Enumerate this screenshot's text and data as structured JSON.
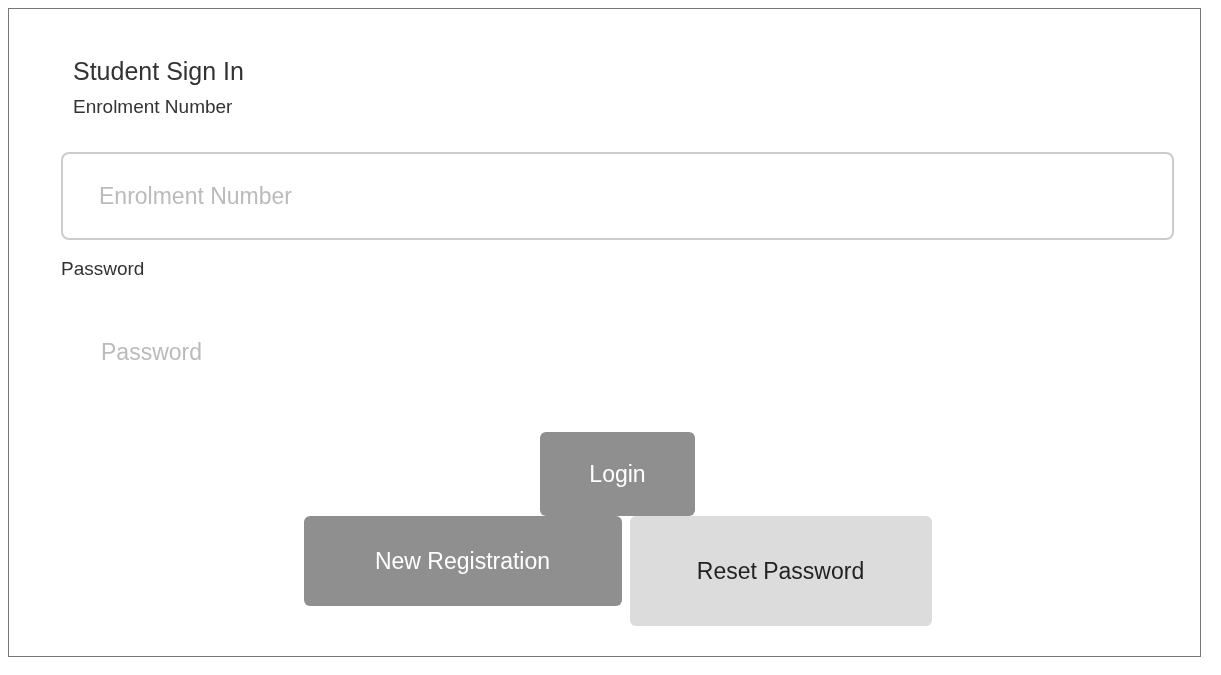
{
  "title": "Student Sign In",
  "fields": [
    {
      "label": "Enrolment Number",
      "placeholder": "Enrolment Number",
      "kind": "bordered"
    },
    {
      "label": "Password",
      "placeholder": "Password",
      "kind": "plain"
    }
  ],
  "buttons": [
    {
      "label": "Login",
      "kind": "primary"
    },
    {
      "label": "New Registration",
      "kind": "primary"
    },
    {
      "label": "Reset Password",
      "kind": "secondary"
    }
  ]
}
